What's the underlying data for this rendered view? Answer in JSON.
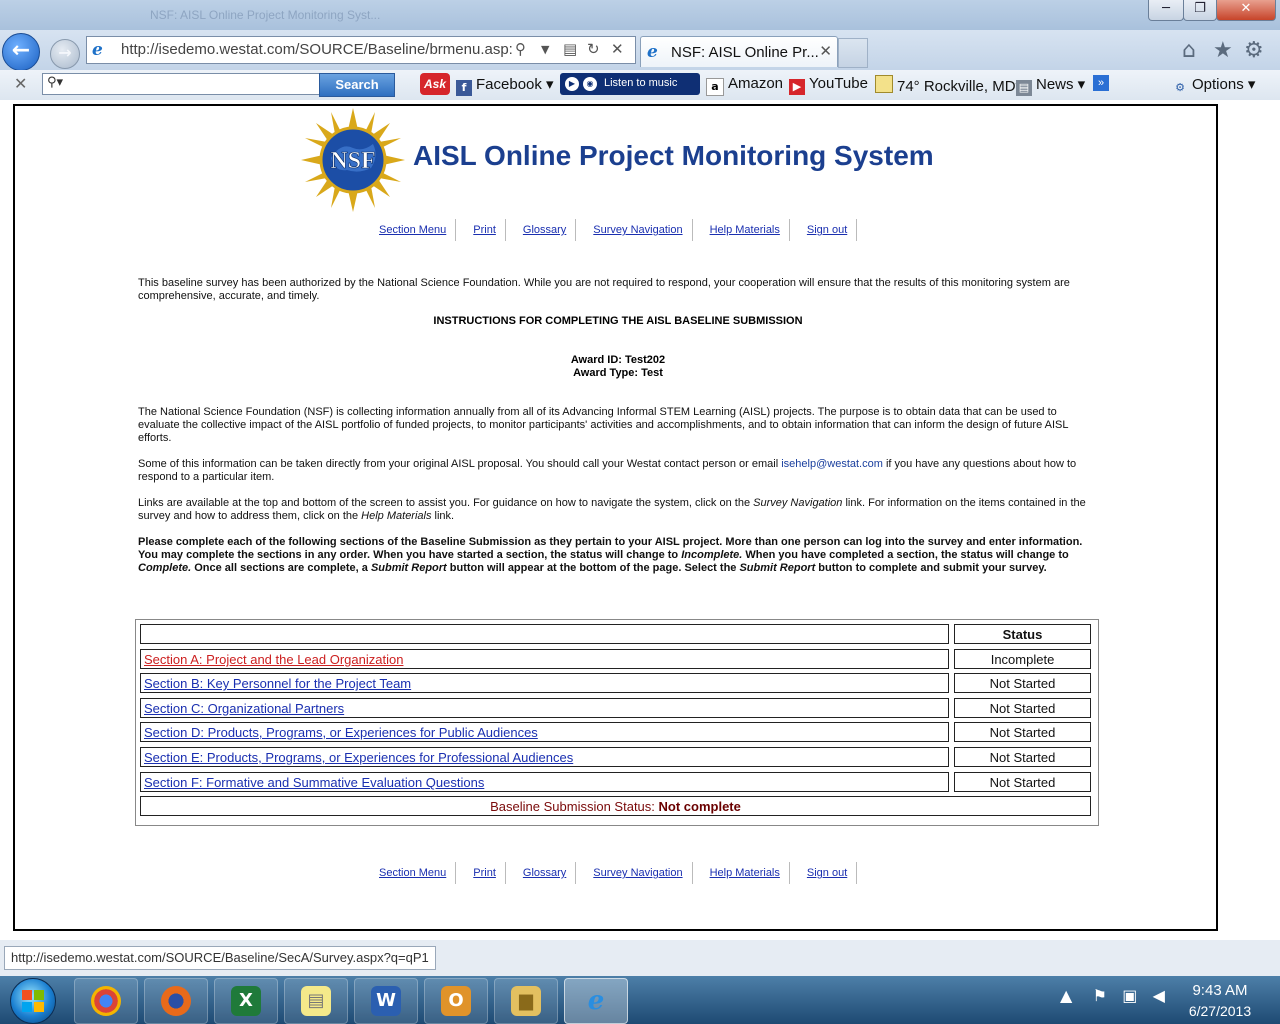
{
  "browser": {
    "ghost_tab_title": "NSF: AISL Online Project Monitoring Syst...",
    "address": "http://isedemo.westat.com/SOURCE/Baseline/brmenu.asp:",
    "tab_title": "NSF: AISL Online Pr...",
    "search_button": "Search",
    "toolbar_items": {
      "facebook": "Facebook",
      "music": "Listen to music",
      "amazon": "Amazon",
      "youtube": "YouTube",
      "weather": "74° Rockville, MD",
      "news": "News",
      "options": "Options"
    }
  },
  "page": {
    "title": "AISL Online Project Monitoring System",
    "logo_text": "NSF",
    "nav": [
      "Section Menu",
      "Print",
      "Glossary",
      "Survey Navigation",
      "Help Materials",
      "Sign out"
    ],
    "intro": "This baseline survey has been authorized by the National Science Foundation. While you are not required to respond, your cooperation will ensure that the results of this monitoring system are comprehensive, accurate, and timely.",
    "instructions_heading": "INSTRUCTIONS FOR COMPLETING THE AISL BASELINE SUBMISSION",
    "award_id": "Award ID: Test202",
    "award_type": "Award Type: Test",
    "p1": "The National Science Foundation (NSF) is collecting information annually from all of its Advancing Informal STEM Learning (AISL) projects. The purpose is to obtain data that can be used to evaluate the collective impact of the AISL portfolio of funded projects, to monitor participants' activities and accomplishments, and to obtain information that can inform the design of future AISL efforts.",
    "p2_before": "Some of this information can be taken directly from your original AISL proposal. You should call your Westat contact person or email ",
    "p2_email": "isehelp@westat.com",
    "p2_after": " if you have any questions about how to respond to a particular item.",
    "p3_a": "Links are available at the top and bottom of the screen to assist you. For guidance on how to navigate the system, click on the ",
    "p3_b": "Survey Navigation",
    "p3_c": " link. For information on the items contained in the survey and how to address them, click on the ",
    "p3_d": "Help Materials",
    "p3_e": " link.",
    "p4_a": "Please complete each of the following sections of the Baseline Submission as they pertain to your AISL project. More than one person can log into the survey and enter information. You may complete the sections in any order. When you have started a section, the status will change to ",
    "p4_b": "Incomplete.",
    "p4_c": " When you have completed a section, the status will change to ",
    "p4_d": "Complete.",
    "p4_e": " Once all sections are complete, a ",
    "p4_f": "Submit Report",
    "p4_g": " button will appear at the bottom of the page. Select the ",
    "p4_h": "Submit Report",
    "p4_i": " button to complete and submit your survey.",
    "table": {
      "status_header": "Status",
      "rows": [
        {
          "label": "Section A: Project and the Lead Organization",
          "status": "Incomplete"
        },
        {
          "label": "Section B: Key Personnel for the Project Team",
          "status": "Not Started"
        },
        {
          "label": "Section C: Organizational Partners",
          "status": "Not Started"
        },
        {
          "label": "Section D: Products, Programs, or Experiences for Public Audiences",
          "status": "Not Started"
        },
        {
          "label": "Section E: Products, Programs, or Experiences for Professional Audiences",
          "status": "Not Started"
        },
        {
          "label": "Section F: Formative and Summative Evaluation Questions",
          "status": "Not Started"
        }
      ],
      "baseline_label": "Baseline Submission Status: ",
      "baseline_value": "Not complete"
    }
  },
  "status_url": "http://isedemo.westat.com/SOURCE/Baseline/SecA/Survey.aspx?q=qP1",
  "taskbar": {
    "time": "9:43 AM",
    "date": "6/27/2013"
  }
}
